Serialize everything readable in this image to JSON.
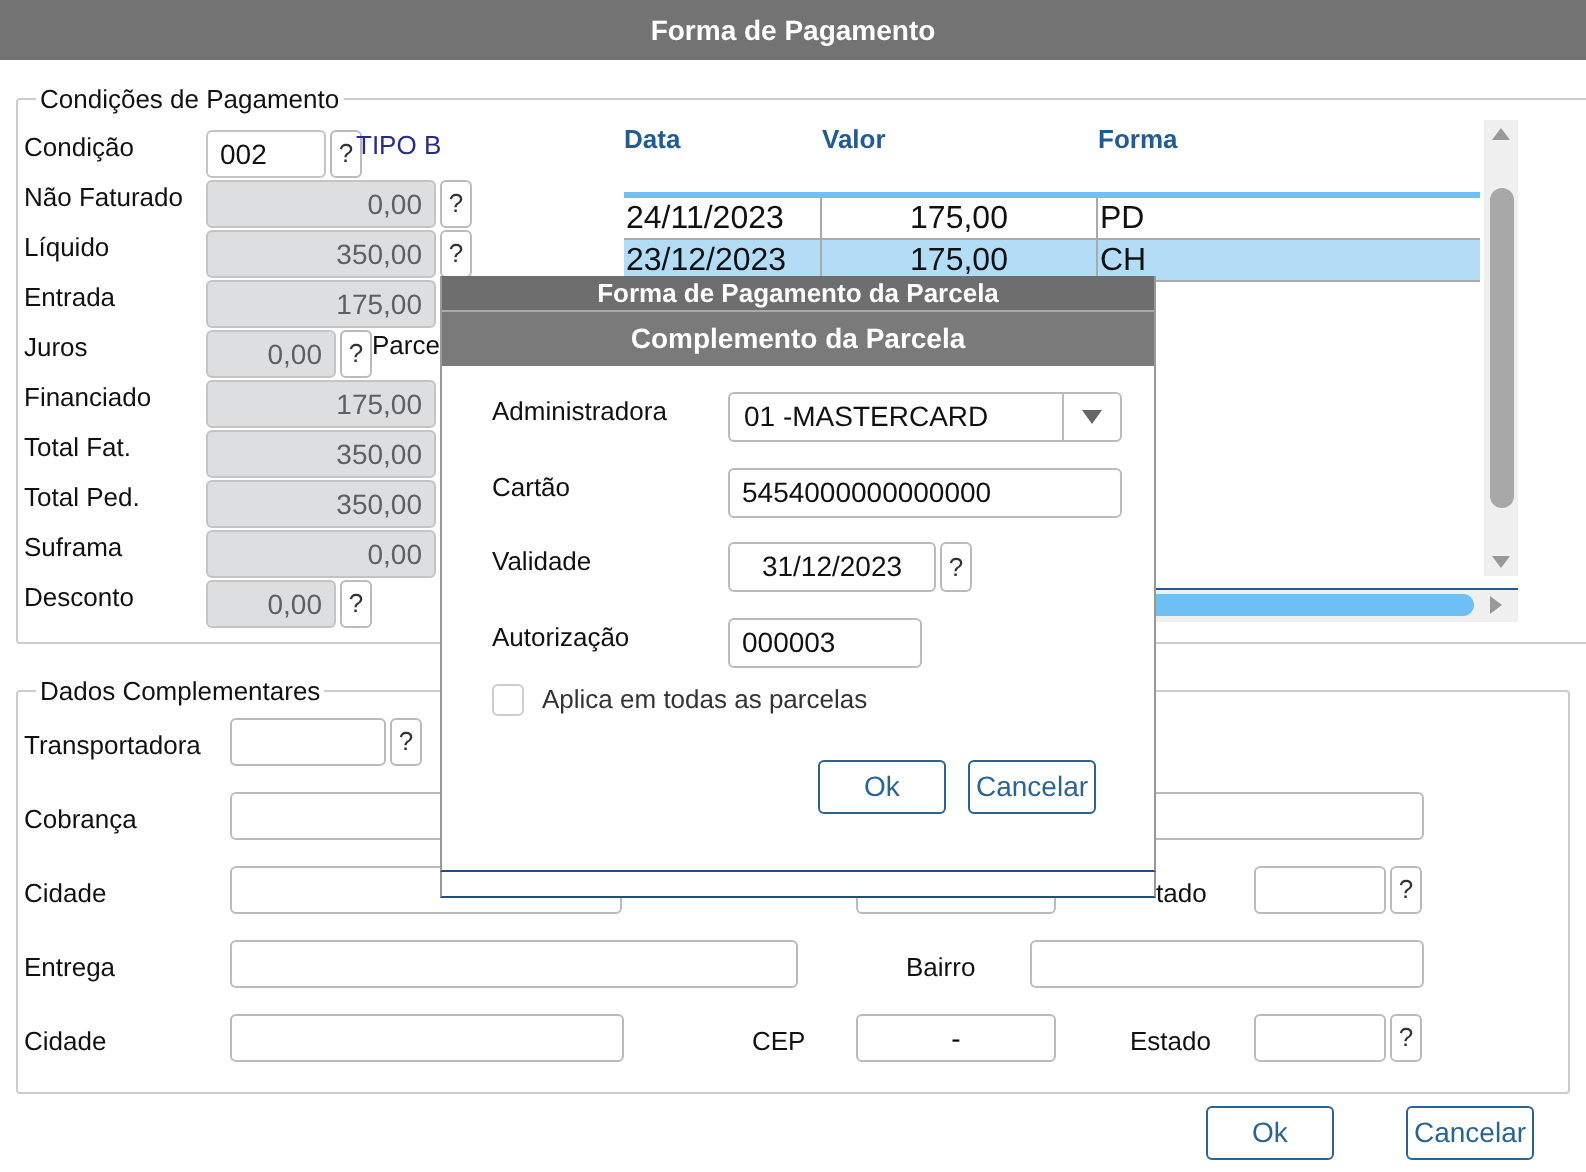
{
  "window": {
    "title": "Forma de Pagamento"
  },
  "payment_conditions": {
    "legend": "Condições de Pagamento",
    "fields": [
      {
        "kind": "lookup",
        "label": "Condição",
        "value": "002",
        "disabled": false,
        "help": "?",
        "note": "TIPO B"
      },
      {
        "kind": "full",
        "label": "Não Faturado",
        "value": "0,00",
        "disabled": true,
        "help": "?"
      },
      {
        "kind": "full",
        "label": "Líquido",
        "value": "350,00",
        "disabled": true,
        "help": "?"
      },
      {
        "kind": "full",
        "label": "Entrada",
        "value": "175,00",
        "disabled": true
      },
      {
        "kind": "short",
        "label": "Juros",
        "value": "0,00",
        "disabled": true,
        "help": "?",
        "note": "Parce"
      },
      {
        "kind": "full",
        "label": "Financiado",
        "value": "175,00",
        "disabled": true
      },
      {
        "kind": "full",
        "label": "Total Fat.",
        "value": "350,00",
        "disabled": true
      },
      {
        "kind": "full",
        "label": "Total Ped.",
        "value": "350,00",
        "disabled": true
      },
      {
        "kind": "full",
        "label": "Suframa",
        "value": "0,00",
        "disabled": true
      },
      {
        "kind": "short",
        "label": "Desconto",
        "value": "0,00",
        "disabled": true,
        "help": "?"
      }
    ]
  },
  "installments": {
    "columns": [
      "Data",
      "Valor",
      "Forma"
    ],
    "rows": [
      {
        "cells": [
          "24/11/2023",
          "175,00",
          "PD"
        ],
        "selected": false
      },
      {
        "cells": [
          "23/12/2023",
          "175,00",
          "CH"
        ],
        "selected": true
      }
    ]
  },
  "additional_data": {
    "legend": "Dados Complementares",
    "rows": [
      {
        "items": [
          {
            "kind": "label",
            "text": "Transportadora"
          },
          {
            "kind": "field"
          },
          {
            "kind": "help",
            "text": "?"
          }
        ]
      },
      {
        "items": [
          {
            "kind": "label",
            "text": "Cobrança"
          },
          {
            "kind": "field"
          }
        ]
      },
      {
        "items": [
          {
            "kind": "label",
            "text": "Cidade"
          },
          {
            "kind": "field"
          },
          {
            "kind": "field"
          },
          {
            "kind": "label",
            "text": "tado"
          },
          {
            "kind": "field"
          },
          {
            "kind": "help",
            "text": "?"
          }
        ]
      },
      {
        "items": [
          {
            "kind": "label",
            "text": "Entrega"
          },
          {
            "kind": "field"
          },
          {
            "kind": "label",
            "text": "Bairro"
          },
          {
            "kind": "field"
          }
        ]
      },
      {
        "items": [
          {
            "kind": "label",
            "text": "Cidade"
          },
          {
            "kind": "field"
          },
          {
            "kind": "label",
            "text": "CEP"
          },
          {
            "kind": "field",
            "value": "-"
          },
          {
            "kind": "label",
            "text": "Estado"
          },
          {
            "kind": "field"
          },
          {
            "kind": "help",
            "text": "?"
          }
        ]
      }
    ]
  },
  "buttons": [
    "Ok",
    "Cancelar"
  ],
  "installment_dialog": {
    "title": "Forma de Pagamento da Parcela"
  },
  "complement_dialog": {
    "title": "Complemento da Parcela",
    "fields": [
      {
        "kind": "select",
        "label": "Administradora",
        "value": "01 -MASTERCARD"
      },
      {
        "kind": "text",
        "label": "Cartão",
        "value": "5454000000000000"
      },
      {
        "kind": "date",
        "label": "Validade",
        "value": "31/12/2023",
        "help": "?"
      },
      {
        "kind": "short",
        "label": "Autorização",
        "value": "000003"
      }
    ],
    "apply_all": {
      "label": "Aplica em todas as parcelas",
      "checked": false
    },
    "buttons": [
      "Ok",
      "Cancelar"
    ]
  }
}
